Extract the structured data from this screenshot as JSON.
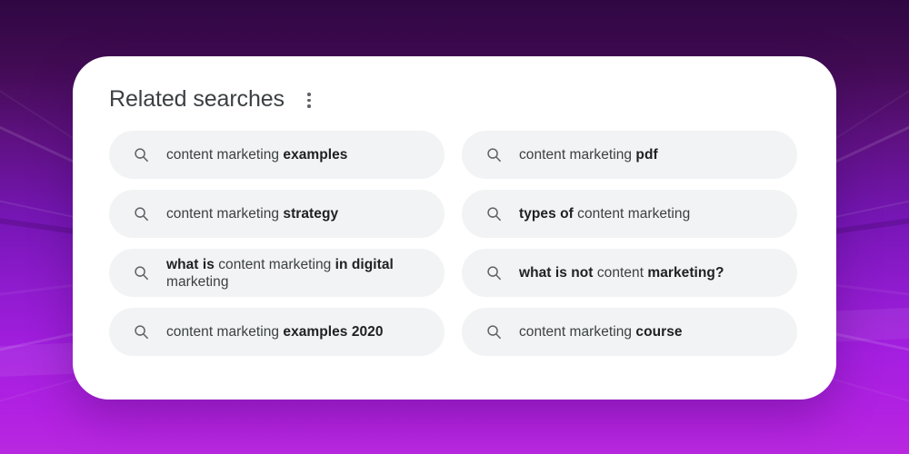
{
  "card": {
    "title": "Related searches",
    "menu_icon": "kebab-menu-icon",
    "search_icon": "search-icon"
  },
  "colors": {
    "card_background": "#ffffff",
    "pill_background": "#f1f3f4",
    "text": "#3c4043",
    "text_bold": "#202124",
    "icon": "#5f6368",
    "backdrop_top": "#3c0a50",
    "backdrop_mid": "#8d1bcc",
    "backdrop_bottom": "#b51ddf"
  },
  "related_searches": [
    {
      "position": "row1-left",
      "full_text": "content marketing examples",
      "segments": [
        {
          "text": "content marketing ",
          "bold": false
        },
        {
          "text": "examples",
          "bold": true
        }
      ]
    },
    {
      "position": "row1-right",
      "full_text": "content marketing pdf",
      "segments": [
        {
          "text": "content marketing ",
          "bold": false
        },
        {
          "text": "pdf",
          "bold": true
        }
      ]
    },
    {
      "position": "row2-left",
      "full_text": "content marketing strategy",
      "segments": [
        {
          "text": "content marketing ",
          "bold": false
        },
        {
          "text": "strategy",
          "bold": true
        }
      ]
    },
    {
      "position": "row2-right",
      "full_text": "types of content marketing",
      "segments": [
        {
          "text": "types of",
          "bold": true
        },
        {
          "text": " content marketing",
          "bold": false
        }
      ]
    },
    {
      "position": "row3-left",
      "full_text": "what is content marketing in digital marketing",
      "segments": [
        {
          "text": "what is",
          "bold": true
        },
        {
          "text": " content marketing ",
          "bold": false
        },
        {
          "text": "in digital",
          "bold": true
        },
        {
          "text": " marketing",
          "bold": false
        }
      ]
    },
    {
      "position": "row3-right",
      "full_text": "what is not content marketing?",
      "segments": [
        {
          "text": "what is not",
          "bold": true
        },
        {
          "text": " content ",
          "bold": false
        },
        {
          "text": "marketing?",
          "bold": true
        }
      ]
    },
    {
      "position": "row4-left",
      "full_text": "content marketing examples 2020",
      "segments": [
        {
          "text": "content marketing ",
          "bold": false
        },
        {
          "text": "examples 2020",
          "bold": true
        }
      ]
    },
    {
      "position": "row4-right",
      "full_text": "content marketing course",
      "segments": [
        {
          "text": "content marketing ",
          "bold": false
        },
        {
          "text": "course",
          "bold": true
        }
      ]
    }
  ]
}
